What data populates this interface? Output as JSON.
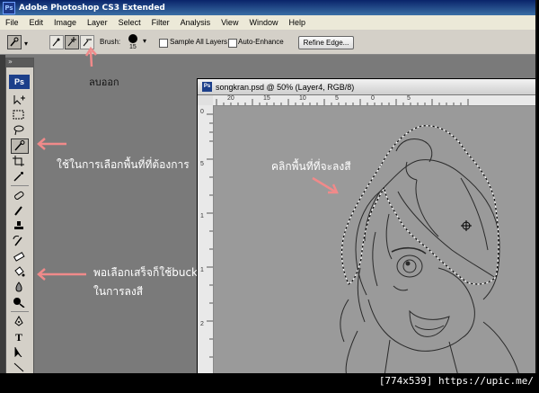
{
  "window_title": "Adobe Photoshop CS3 Extended",
  "menu": [
    "File",
    "Edit",
    "Image",
    "Layer",
    "Select",
    "Filter",
    "Analysis",
    "View",
    "Window",
    "Help"
  ],
  "options_bar": {
    "brush_label": "Brush:",
    "brush_size": "15",
    "sample_all_layers": "Sample All Layers",
    "auto_enhance": "Auto-Enhance",
    "refine_edge": "Refine Edge..."
  },
  "tools": {
    "ps_logo": "Ps"
  },
  "document": {
    "ps_badge": "Ps",
    "title": "songkran.psd @ 50% (Layer4, RGB/8)",
    "h_ticks": [
      "20",
      "15",
      "10",
      "5",
      "0",
      "5"
    ],
    "v_ticks": [
      "0",
      "5",
      "1",
      "1",
      "2"
    ]
  },
  "annotations": {
    "remove": "ลบออก",
    "select_area": "ใช้ในการเลือกพื้นที่ที่ต้องการ",
    "click_area": "คลิกพื้นที่ที่จะลงสี",
    "bucket_line1": "พอเลือกเสร็จก็ใช้bucket",
    "bucket_line2": "ในการลงสี",
    "arrow_color": "#f08a8a"
  },
  "watermark": "[774x539] https://upic.me/"
}
